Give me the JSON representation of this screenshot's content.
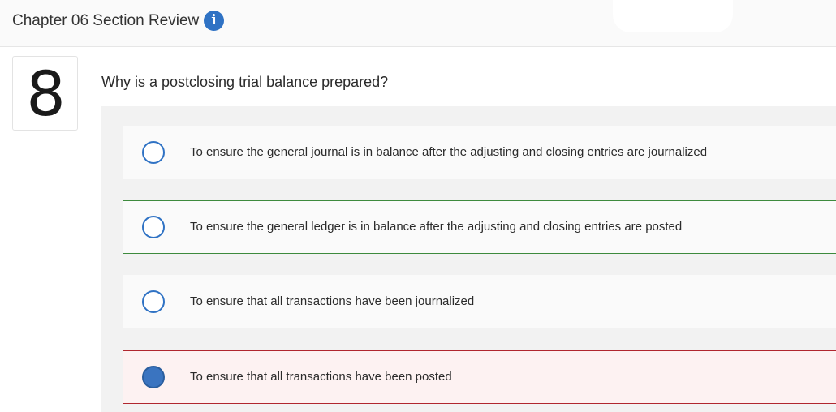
{
  "header": {
    "title": "Chapter 06 Section Review",
    "info_icon": "info-icon"
  },
  "question": {
    "number": "8",
    "prompt": "Why is a postclosing trial balance prepared?",
    "options": [
      {
        "label": "To ensure the general journal is in balance after the adjusting and closing entries are journalized",
        "selected": false,
        "status": "none"
      },
      {
        "label": "To ensure the general ledger is in balance after the adjusting and closing entries are posted",
        "selected": false,
        "status": "correct"
      },
      {
        "label": "To ensure that all transactions have been journalized",
        "selected": false,
        "status": "none"
      },
      {
        "label": "To ensure that all transactions have been posted",
        "selected": true,
        "status": "incorrect"
      }
    ]
  },
  "colors": {
    "accent": "#2f72c4",
    "correct_border": "#3d8a3d",
    "incorrect_border": "#b0272f",
    "incorrect_bg": "#fdf2f2"
  }
}
